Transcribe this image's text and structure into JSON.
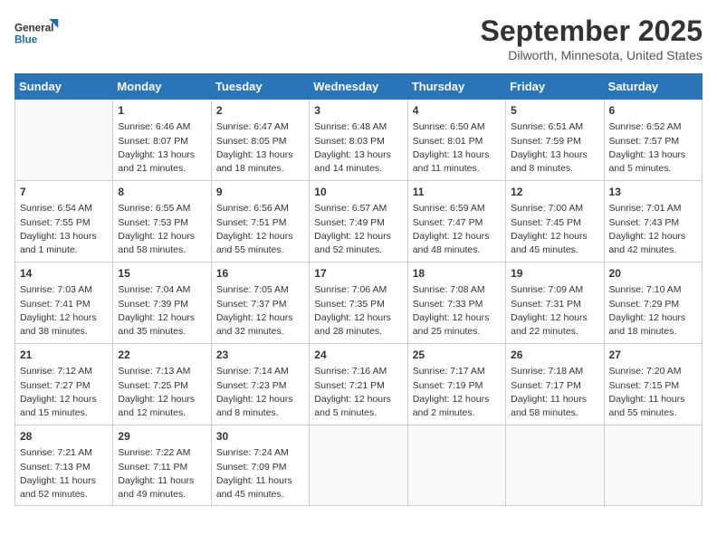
{
  "logo": {
    "line1": "General",
    "line2": "Blue"
  },
  "title": "September 2025",
  "location": "Dilworth, Minnesota, United States",
  "days_of_week": [
    "Sunday",
    "Monday",
    "Tuesday",
    "Wednesday",
    "Thursday",
    "Friday",
    "Saturday"
  ],
  "weeks": [
    [
      {
        "day": "",
        "info": ""
      },
      {
        "day": "1",
        "info": "Sunrise: 6:46 AM\nSunset: 8:07 PM\nDaylight: 13 hours\nand 21 minutes."
      },
      {
        "day": "2",
        "info": "Sunrise: 6:47 AM\nSunset: 8:05 PM\nDaylight: 13 hours\nand 18 minutes."
      },
      {
        "day": "3",
        "info": "Sunrise: 6:48 AM\nSunset: 8:03 PM\nDaylight: 13 hours\nand 14 minutes."
      },
      {
        "day": "4",
        "info": "Sunrise: 6:50 AM\nSunset: 8:01 PM\nDaylight: 13 hours\nand 11 minutes."
      },
      {
        "day": "5",
        "info": "Sunrise: 6:51 AM\nSunset: 7:59 PM\nDaylight: 13 hours\nand 8 minutes."
      },
      {
        "day": "6",
        "info": "Sunrise: 6:52 AM\nSunset: 7:57 PM\nDaylight: 13 hours\nand 5 minutes."
      }
    ],
    [
      {
        "day": "7",
        "info": "Sunrise: 6:54 AM\nSunset: 7:55 PM\nDaylight: 13 hours\nand 1 minute."
      },
      {
        "day": "8",
        "info": "Sunrise: 6:55 AM\nSunset: 7:53 PM\nDaylight: 12 hours\nand 58 minutes."
      },
      {
        "day": "9",
        "info": "Sunrise: 6:56 AM\nSunset: 7:51 PM\nDaylight: 12 hours\nand 55 minutes."
      },
      {
        "day": "10",
        "info": "Sunrise: 6:57 AM\nSunset: 7:49 PM\nDaylight: 12 hours\nand 52 minutes."
      },
      {
        "day": "11",
        "info": "Sunrise: 6:59 AM\nSunset: 7:47 PM\nDaylight: 12 hours\nand 48 minutes."
      },
      {
        "day": "12",
        "info": "Sunrise: 7:00 AM\nSunset: 7:45 PM\nDaylight: 12 hours\nand 45 minutes."
      },
      {
        "day": "13",
        "info": "Sunrise: 7:01 AM\nSunset: 7:43 PM\nDaylight: 12 hours\nand 42 minutes."
      }
    ],
    [
      {
        "day": "14",
        "info": "Sunrise: 7:03 AM\nSunset: 7:41 PM\nDaylight: 12 hours\nand 38 minutes."
      },
      {
        "day": "15",
        "info": "Sunrise: 7:04 AM\nSunset: 7:39 PM\nDaylight: 12 hours\nand 35 minutes."
      },
      {
        "day": "16",
        "info": "Sunrise: 7:05 AM\nSunset: 7:37 PM\nDaylight: 12 hours\nand 32 minutes."
      },
      {
        "day": "17",
        "info": "Sunrise: 7:06 AM\nSunset: 7:35 PM\nDaylight: 12 hours\nand 28 minutes."
      },
      {
        "day": "18",
        "info": "Sunrise: 7:08 AM\nSunset: 7:33 PM\nDaylight: 12 hours\nand 25 minutes."
      },
      {
        "day": "19",
        "info": "Sunrise: 7:09 AM\nSunset: 7:31 PM\nDaylight: 12 hours\nand 22 minutes."
      },
      {
        "day": "20",
        "info": "Sunrise: 7:10 AM\nSunset: 7:29 PM\nDaylight: 12 hours\nand 18 minutes."
      }
    ],
    [
      {
        "day": "21",
        "info": "Sunrise: 7:12 AM\nSunset: 7:27 PM\nDaylight: 12 hours\nand 15 minutes."
      },
      {
        "day": "22",
        "info": "Sunrise: 7:13 AM\nSunset: 7:25 PM\nDaylight: 12 hours\nand 12 minutes."
      },
      {
        "day": "23",
        "info": "Sunrise: 7:14 AM\nSunset: 7:23 PM\nDaylight: 12 hours\nand 8 minutes."
      },
      {
        "day": "24",
        "info": "Sunrise: 7:16 AM\nSunset: 7:21 PM\nDaylight: 12 hours\nand 5 minutes."
      },
      {
        "day": "25",
        "info": "Sunrise: 7:17 AM\nSunset: 7:19 PM\nDaylight: 12 hours\nand 2 minutes."
      },
      {
        "day": "26",
        "info": "Sunrise: 7:18 AM\nSunset: 7:17 PM\nDaylight: 11 hours\nand 58 minutes."
      },
      {
        "day": "27",
        "info": "Sunrise: 7:20 AM\nSunset: 7:15 PM\nDaylight: 11 hours\nand 55 minutes."
      }
    ],
    [
      {
        "day": "28",
        "info": "Sunrise: 7:21 AM\nSunset: 7:13 PM\nDaylight: 11 hours\nand 52 minutes."
      },
      {
        "day": "29",
        "info": "Sunrise: 7:22 AM\nSunset: 7:11 PM\nDaylight: 11 hours\nand 49 minutes."
      },
      {
        "day": "30",
        "info": "Sunrise: 7:24 AM\nSunset: 7:09 PM\nDaylight: 11 hours\nand 45 minutes."
      },
      {
        "day": "",
        "info": ""
      },
      {
        "day": "",
        "info": ""
      },
      {
        "day": "",
        "info": ""
      },
      {
        "day": "",
        "info": ""
      }
    ]
  ]
}
